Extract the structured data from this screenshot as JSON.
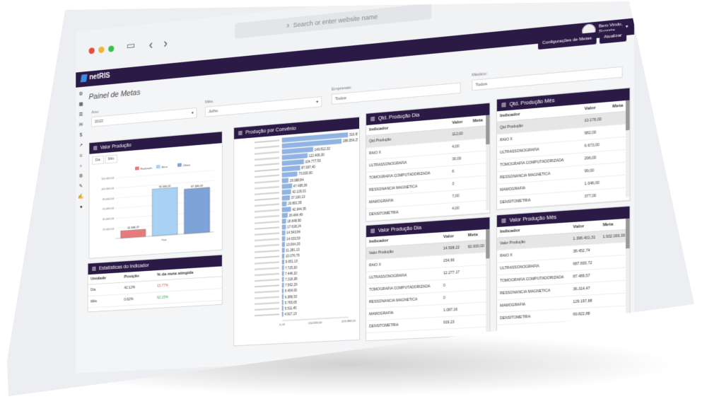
{
  "browser": {
    "url_placeholder": "Search or enter website name",
    "back": "‹",
    "forward": "›",
    "new_tab": "+",
    "tabs_icon": "⧉"
  },
  "app": {
    "brand": "netRIS",
    "user_greeting": "Bem Vindo,",
    "user_role": "Suporte",
    "page_title": "Painel de Metas",
    "buttons": {
      "config": "Configurações de Metas",
      "update": "Atualizar"
    }
  },
  "filters": {
    "year": {
      "label": "Ano:",
      "value": "2022"
    },
    "month": {
      "label": "Mês:",
      "value": "Julho"
    },
    "company": {
      "label": "Empresas:",
      "value": "Todos"
    },
    "doctor": {
      "label": "Médico:",
      "value": "Todos"
    }
  },
  "valor_producao": {
    "title": "Valor Produção",
    "tabs": [
      "Dia",
      "Mês"
    ],
    "legend": [
      "Realizado",
      "Meta",
      "Último"
    ],
    "yticks": [
      "120.000,00",
      "100.000,00",
      "80.000,00",
      "60.000,00",
      "40.000,00",
      "20.000,00"
    ],
    "xlabel": "Hoje"
  },
  "chart_data": [
    {
      "type": "bar",
      "title": "Valor Produção",
      "categories": [
        "Hoje"
      ],
      "series": [
        {
          "name": "Realizado",
          "values": [
            14508.22
          ]
        },
        {
          "name": "Meta",
          "values": [
            92000
          ]
        },
        {
          "name": "Último",
          "values": [
            87400
          ]
        }
      ],
      "labels": [
        "14.508,22",
        "92.000,00",
        "87.400,00"
      ],
      "ylim": [
        0,
        120000
      ],
      "colors": [
        "#e77b7b",
        "#a9d1f3",
        "#7ea3d9"
      ]
    },
    {
      "type": "bar",
      "title": "Produção por Convênio",
      "orientation": "horizontal",
      "values": [
        316650,
        286054,
        149812,
        122406,
        104777,
        87097,
        73000,
        29998,
        47438,
        42120,
        37100,
        20801,
        42344,
        26464,
        18648,
        17618,
        14543,
        14033,
        13064,
        11281,
        10076,
        9651,
        7725,
        7446,
        7218,
        7562,
        6454,
        6386,
        5765,
        5511,
        4917
      ],
      "labels": [
        "316.650,17",
        "286.054,25",
        "149.812,32",
        "122.406,30",
        "104.777,53",
        "87.097,40",
        "73.000,00",
        "29.998,84",
        "47.438,36",
        "42.120,01",
        "37.100,13",
        "20.801,55",
        "42.344,35",
        "26.464,49",
        "18.648,80",
        "17.618,24",
        "14.543,84",
        "14.033,53",
        "13.064,33",
        "11.281,13",
        "10.076,79",
        "9.651,13",
        "7.725,00",
        "7.446,32",
        "7.218,38",
        "7.562,29",
        "6.454,00",
        "6.386,53",
        "5.765,65",
        "5.511,45",
        "4.917,13"
      ],
      "xticks": [
        "0,00",
        "104.884,00",
        "209.988,00"
      ],
      "xlim": [
        0,
        320000
      ]
    }
  ],
  "conv_title": "Produção por Convênio",
  "estatisticas": {
    "title": "Estatísticas do Indicador",
    "headers": [
      "Unidade",
      "Posição",
      "% da meta atingida"
    ],
    "rows": [
      {
        "unidade": "Dia",
        "posicao": "42.12%",
        "meta": "15.77%",
        "color": "#e05050"
      },
      {
        "unidade": "Mês",
        "posicao": "0.62%",
        "meta": "62.15%",
        "color": "#3aa844"
      }
    ]
  },
  "qtd_dia": {
    "title": "Qtd. Produção Dia",
    "headers": [
      "Indicador",
      "Valor",
      "Meta"
    ],
    "rows": [
      [
        "Qtd Produção",
        "112,00",
        ""
      ],
      [
        "RAIO X",
        "4,00",
        ""
      ],
      [
        "ULTRASSONOGRAFIA",
        "30,00",
        ""
      ],
      [
        "TOMOGRAFIA COMPUTADORIZADA",
        "6",
        ""
      ],
      [
        "RESSONANCIA MAGNETICA",
        "3",
        ""
      ],
      [
        "MAMOGRAFIA",
        "7,00",
        ""
      ],
      [
        "DENSITOMETRIA",
        "4,00",
        ""
      ]
    ]
  },
  "qtd_mes": {
    "title": "Qtd. Produção Mês",
    "headers": [
      "Indicador",
      "Valor",
      "Meta"
    ],
    "rows": [
      [
        "Qtd Produção",
        "10.176,00",
        ""
      ],
      [
        "RAIO X",
        "982,00",
        ""
      ],
      [
        "ULTRASSONOGRAFIA",
        "6.673,00",
        ""
      ],
      [
        "TOMOGRAFIA COMPUTADORIZADA",
        "296,00",
        ""
      ],
      [
        "RESSONANCIA MAGNETICA",
        "99,00",
        ""
      ],
      [
        "MAMOGRAFIA",
        "1.046,00",
        ""
      ],
      [
        "DENSITOMETRIA",
        "377,00",
        ""
      ]
    ]
  },
  "valor_dia": {
    "title": "Valor Produção Dia",
    "headers": [
      "Indicador",
      "Valor",
      "Meta"
    ],
    "rows": [
      [
        "Valor Produção",
        "14.508,22",
        "92.000,00"
      ],
      [
        "RAIO X",
        "234,66",
        ""
      ],
      [
        "ULTRASSONOGRAFIA",
        "12.277,17",
        ""
      ],
      [
        "TOMOGRAFIA COMPUTADORIZADA",
        "0",
        ""
      ],
      [
        "RESSONANCIA MAGNETICA",
        "0",
        ""
      ],
      [
        "MAMOGRAFIA",
        "1.087,16",
        ""
      ],
      [
        "DENSITOMETRIA",
        "919,23",
        ""
      ]
    ]
  },
  "valor_mes": {
    "title": "Valor Produção Mês",
    "headers": [
      "Indicador",
      "Valor",
      "Meta"
    ],
    "rows": [
      [
        "Valor Produção",
        "1.396.401,31",
        "1.932.000,00"
      ],
      [
        "RAIO X",
        "38.452,74",
        ""
      ],
      [
        "ULTRASSONOGRAFIA",
        "687.830,72",
        ""
      ],
      [
        "TOMOGRAFIA COMPUTADORIZADA",
        "87.489,57",
        ""
      ],
      [
        "RESSONANCIA MAGNETICA",
        "36.314,47",
        ""
      ],
      [
        "MAMOGRAFIA",
        "129.197,88",
        ""
      ],
      [
        "DENSITOMETRIA",
        "69.822,88",
        ""
      ]
    ]
  }
}
